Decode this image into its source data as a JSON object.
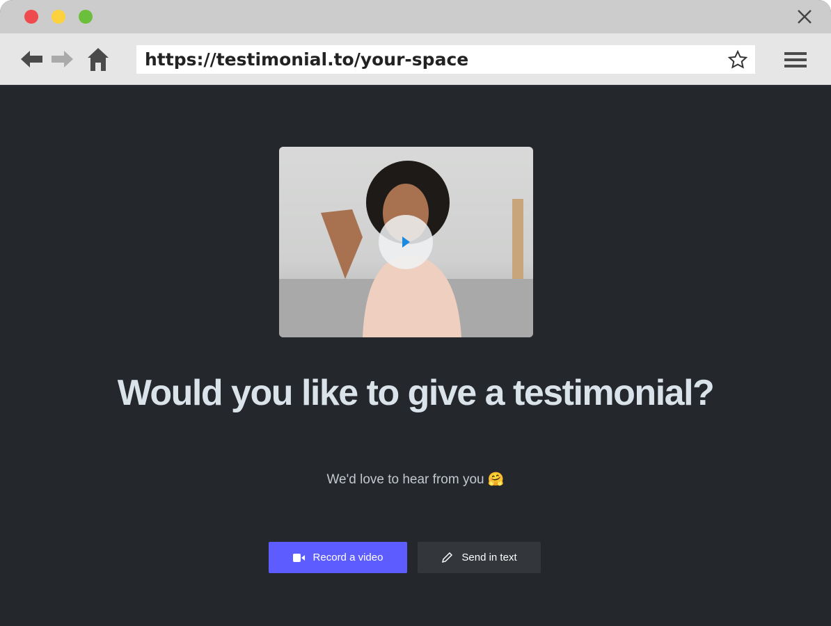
{
  "browser": {
    "url": "https://testimonial.to/your-space",
    "traffic_colors": [
      "#ef4b4e",
      "#fdd23d",
      "#6cbf3a"
    ]
  },
  "main": {
    "heading": "Would you like to give a testimonial?",
    "subtitle": "We'd love to hear from you",
    "subtitle_emoji": "🤗",
    "record_button": "Record a video",
    "text_button": "Send in text",
    "accent": "#5d5dff"
  }
}
